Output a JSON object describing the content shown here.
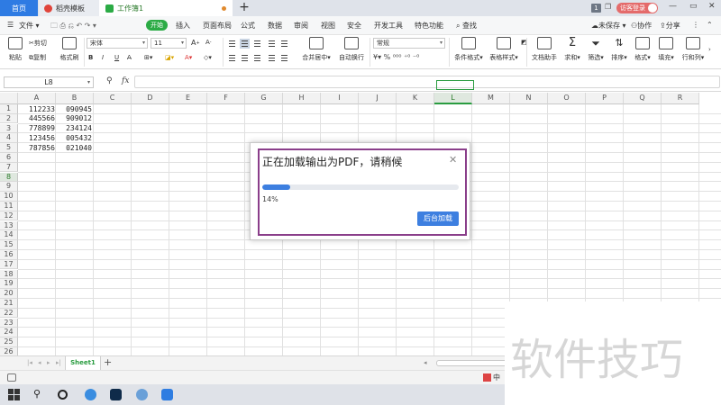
{
  "titlebar": {
    "tabs": [
      {
        "label": "首页"
      },
      {
        "label": "稻壳模板"
      },
      {
        "label": "工作簿1"
      }
    ],
    "badge": "1",
    "login": "访客登录"
  },
  "menu": {
    "file": "文件",
    "start": "开始",
    "items": [
      "插入",
      "页面布局",
      "公式",
      "数据",
      "审阅",
      "视图",
      "安全",
      "开发工具",
      "特色功能"
    ],
    "search": "查找",
    "unsaved": "未保存",
    "collab": "协作",
    "share": "分享"
  },
  "ribbon": {
    "paste": "粘贴",
    "cut": "剪切",
    "copy": "复制",
    "format_painter": "格式刷",
    "font_name": "宋体",
    "font_size": "11",
    "merge_center": "合并居中",
    "wrap_text": "自动换行",
    "number_format": "常规",
    "cond_format": "条件格式",
    "table_style": "表格样式",
    "doc_helper": "文档助手",
    "sum": "求和",
    "filter": "筛选",
    "sort": "排序",
    "format": "格式",
    "fill": "填充",
    "row_col": "行和列"
  },
  "formula_bar": {
    "name_box": "L8",
    "fx": "fx",
    "value": ""
  },
  "grid": {
    "columns": [
      "A",
      "B",
      "C",
      "D",
      "E",
      "F",
      "G",
      "H",
      "I",
      "J",
      "K",
      "L",
      "M",
      "N",
      "O",
      "P",
      "Q",
      "R"
    ],
    "selected_column": "L",
    "rows": [
      "1",
      "2",
      "3",
      "4",
      "5",
      "6",
      "7",
      "8",
      "9",
      "10",
      "11",
      "12",
      "13",
      "14",
      "15",
      "16",
      "17",
      "18",
      "19",
      "20",
      "21",
      "22",
      "23",
      "24",
      "25",
      "26"
    ],
    "selected_row": "8",
    "cells": [
      {
        "a": "112233",
        "b": "090945"
      },
      {
        "a": "445566",
        "b": "909012"
      },
      {
        "a": "778899",
        "b": "234124"
      },
      {
        "a": "123456",
        "b": "005432"
      },
      {
        "a": "787856",
        "b": "021040"
      }
    ]
  },
  "sheets": {
    "active": "Sheet1",
    "add": "+"
  },
  "status": {
    "ime": "中"
  },
  "dialog": {
    "title": "正在加载输出为PDF，请稍候",
    "progress_percent": 14,
    "progress_label": "14%",
    "background_button": "后台加载"
  },
  "watermark": "软件技巧",
  "colors": {
    "accent_blue": "#3d7fe0",
    "start_green": "#2bab45",
    "dialog_border": "#8a3e8a",
    "login_red": "#e46b6b"
  }
}
